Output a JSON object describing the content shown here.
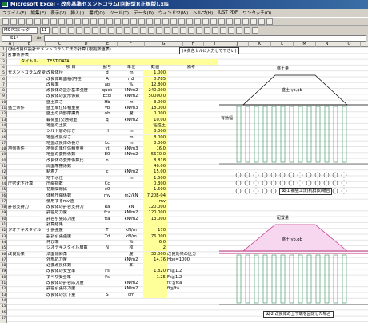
{
  "window": {
    "title": "Microsoft Excel - 改良基準セメントコラム(回転型)(正規版).xls"
  },
  "menu": [
    "ファイル(F)",
    "編集(E)",
    "表示(V)",
    "挿入(I)",
    "書式(O)",
    "ツール(T)",
    "データ(D)",
    "ウィンドウ(W)",
    "ヘルプ(H)",
    "JUST PDF",
    "ワンタッチ(O)"
  ],
  "font_name": "MS Pゴシック",
  "font_size": "11",
  "cell_ref": "S14",
  "columns": [
    "A",
    "B",
    "C",
    "D",
    "E",
    "F",
    "G",
    "H",
    "I",
    "J",
    "K",
    "L",
    "M",
    "N",
    "O",
    "P"
  ],
  "rows": [
    "1",
    "2",
    "3",
    "4",
    "5",
    "6",
    "7",
    "8",
    "9",
    "10",
    "11",
    "12",
    "13",
    "14",
    "15",
    "16",
    "17",
    "18",
    "19",
    "20",
    "21",
    "22",
    "23",
    "24",
    "25",
    "26",
    "27",
    "28",
    "29",
    "30",
    "31",
    "32",
    "33",
    "34",
    "35",
    "36",
    "37",
    "38",
    "39",
    "40",
    "41",
    "42",
    "43",
    "44",
    "45",
    "46",
    "47"
  ],
  "sheet": {
    "title": "(仮)改良体設計セメントコラム工法の計算 (根拠数値表)",
    "sub": "計算条件表",
    "note": "(※黄色セルに入力して下さい)",
    "name_label": "タイトル",
    "name_value": "TEST-DATA",
    "header": [
      "項 目",
      "記号",
      "単位",
      "数値",
      "備考"
    ],
    "lines": [
      [
        "セメントコラム改良体",
        "改良体径",
        "d",
        "m",
        "1.000",
        ""
      ],
      [
        "",
        "改良体断面積(円柱)",
        "A",
        "m2",
        "0.785",
        ""
      ],
      [
        "",
        "改良率",
        "ap",
        "%",
        "12.800",
        ""
      ],
      [
        "",
        "改良体の設計基準強度",
        "quck",
        "kN/m2",
        "240.000",
        ""
      ],
      [
        "",
        "改良体の変形係数",
        "Ecol",
        "kN/m2",
        "50000.0",
        ""
      ],
      [
        "",
        "盛土高さ",
        "Hb",
        "m",
        "3.000",
        ""
      ],
      [
        "盛土条件",
        "盛土単位体積重量",
        "γb",
        "kN/m3",
        "18.000",
        ""
      ],
      [
        "",
        "盛土の内部摩擦角",
        "φb",
        "度",
        "0.000",
        ""
      ],
      [
        "",
        "載荷重(交通荷重)",
        "q",
        "kN/m2",
        "10.00",
        ""
      ],
      [
        "",
        "地盤の土質",
        "",
        "",
        "粘性土",
        ""
      ],
      [
        "",
        "シルト層の厚さ",
        "H",
        "m",
        "8.000",
        ""
      ],
      [
        "",
        "地盤改良深さ",
        "",
        "m",
        "8.000",
        ""
      ],
      [
        "",
        "地盤改良体の長さ",
        "Lc",
        "m",
        "8.000",
        ""
      ],
      [
        "地盤条件",
        "地盤の単位体積重量",
        "γt",
        "kN/m3",
        "16.0",
        ""
      ],
      [
        "",
        "地盤の変形係数",
        "E0",
        "kN/m2",
        "5670.0",
        ""
      ],
      [
        "",
        "改良体の変形係数比",
        "n",
        "",
        "8.818",
        ""
      ],
      [
        "",
        "周面摩擦係数",
        "",
        "",
        "40.00",
        ""
      ],
      [
        "",
        "粘着力",
        "c",
        "kN/m2",
        "15.00",
        ""
      ],
      [
        "",
        "地下水位",
        "",
        "m",
        "1.500",
        ""
      ],
      [
        "圧密沈下計算",
        "圧縮指数",
        "Cc",
        "",
        "0.300",
        ""
      ],
      [
        "",
        "初期間隙比",
        "e0",
        "",
        "1.500",
        ""
      ],
      [
        "",
        "体積圧縮係数",
        "mv",
        "m2/kN",
        "7.20E-04",
        ""
      ],
      [
        "",
        "使用するmv値",
        "",
        "",
        "mv",
        ""
      ],
      [
        "許容支持力",
        "改良体の許容支持力",
        "Ra",
        "kN",
        "120.000",
        ""
      ],
      [
        "",
        "許容応力度",
        "fca",
        "kN/m2",
        "120.000",
        ""
      ],
      [
        "",
        "許容引張応力度",
        "fta",
        "kN/m2",
        "13.000",
        ""
      ],
      [
        "",
        "計算結果",
        "",
        "",
        "",
        ""
      ],
      [
        "ジオテキスタイル",
        "引張強度",
        "T",
        "kN/m",
        "170",
        ""
      ],
      [
        "",
        "設計引張強度",
        "Td",
        "kN/m",
        "76.000",
        ""
      ],
      [
        "",
        "伸び率",
        "",
        "%",
        "6.0",
        ""
      ],
      [
        "",
        "ジオテキスタイル層数",
        "N",
        "枚",
        "2",
        ""
      ],
      [
        "改良効果",
        "法面傾斜角",
        "",
        "度",
        "30.000",
        "改良効果の区分"
      ],
      [
        "",
        "外部応力度",
        "",
        "kN/m2",
        "14.76",
        "Hbe=1000"
      ],
      [
        "",
        "必要改良体数",
        "",
        "本",
        "",
        ""
      ],
      [
        "",
        "改良体の安全率",
        "Fs",
        "",
        "1.820",
        "Fs≧1.2"
      ],
      [
        "",
        "すべり安全率",
        "Fs",
        "",
        "1.25",
        "Fs≧1.2"
      ],
      [
        "",
        "改良体の許容応力度",
        "",
        "kN/m2",
        "",
        "fc'≦fca"
      ],
      [
        "",
        "許容引張応力度",
        "",
        "kN/m2",
        "",
        "ft≦fta"
      ],
      [
        "",
        "改良体の沈下量",
        "S",
        "cm",
        "",
        ""
      ]
    ]
  },
  "figures": {
    "top_label": "図-1 補強工法(杭群)の場合",
    "bottom_label": "図-2 改良体の上下端を固定した場合",
    "labels": [
      "盛土量",
      "盛土 γb,φb",
      "盛土高",
      "有効幅",
      "H",
      "D",
      "粘着力",
      "S",
      "配置量",
      "盛土 γb,φb"
    ]
  }
}
